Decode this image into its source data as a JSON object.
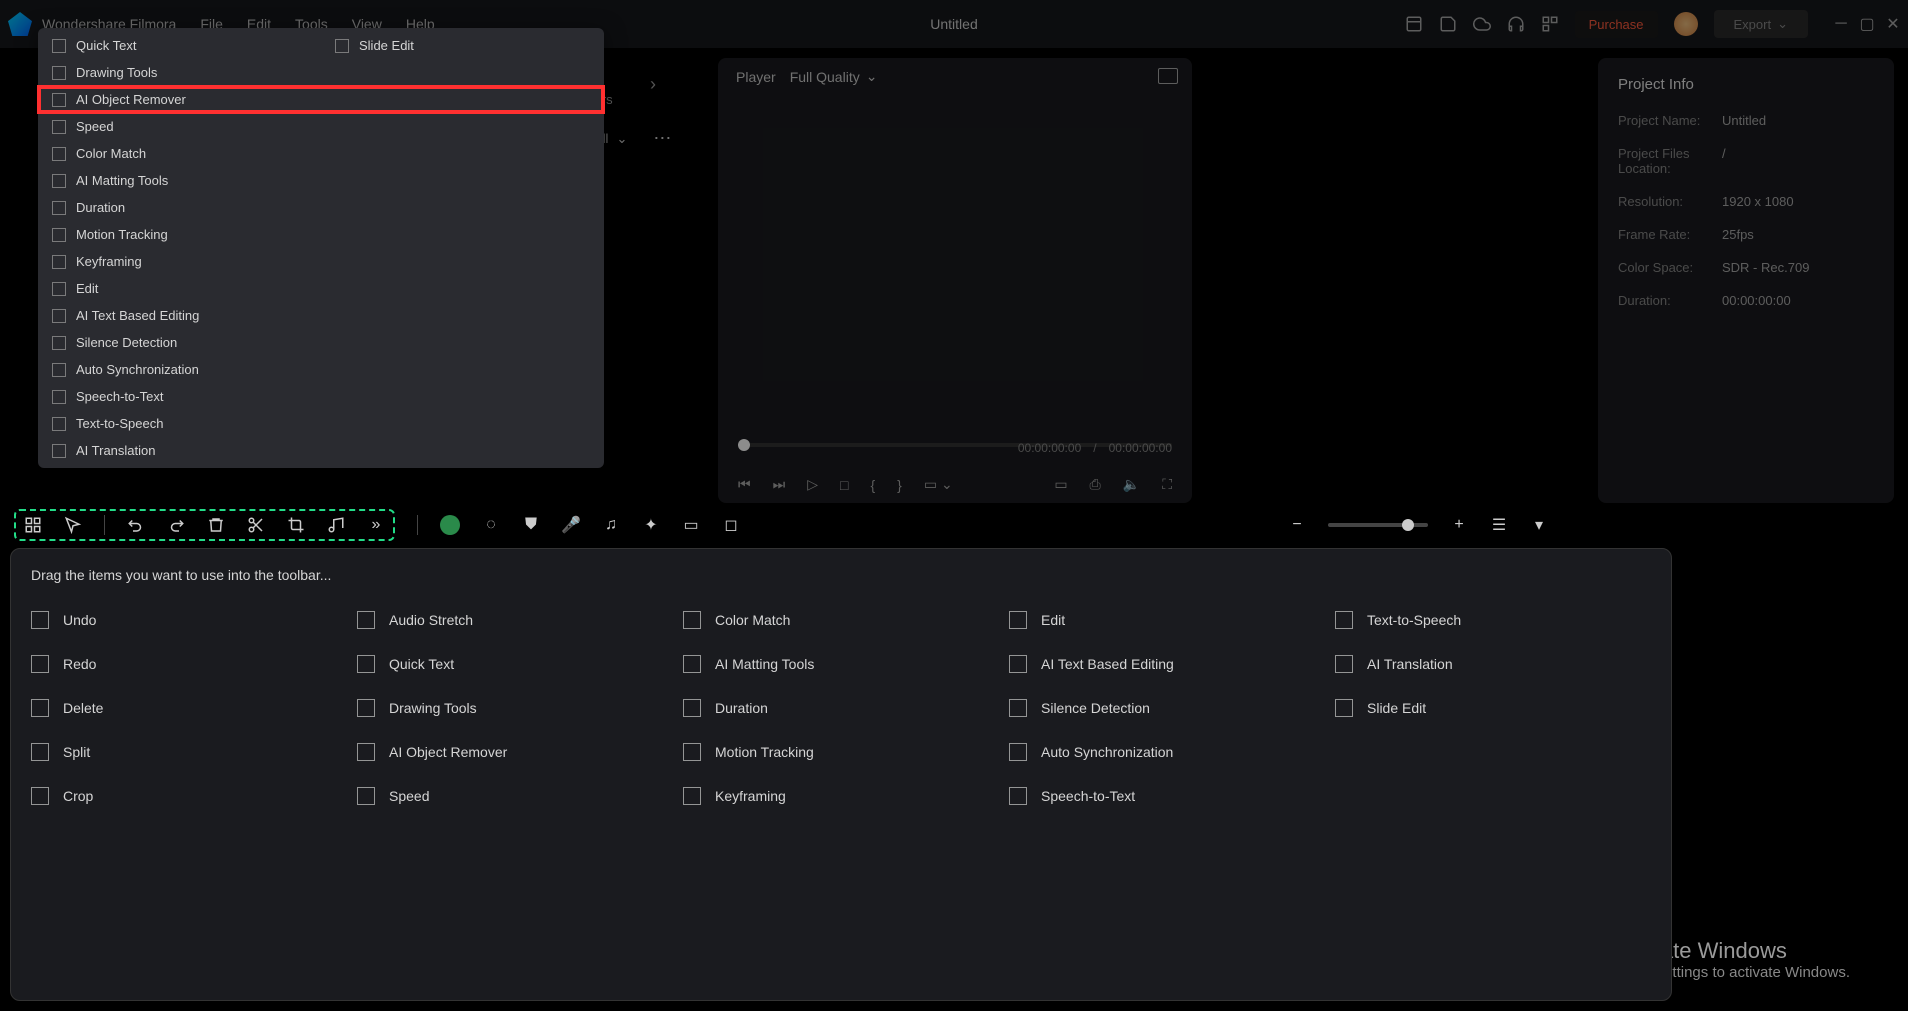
{
  "app": {
    "menubar": [
      "Wondershare Filmora",
      "File",
      "Edit",
      "Tools",
      "View",
      "Help"
    ],
    "title": "Untitled",
    "purchase": "Purchase",
    "export": "Export"
  },
  "dropdown": {
    "row1a": "Quick Text",
    "row1b": "Slide Edit",
    "items": [
      "Drawing Tools",
      "AI Object Remover",
      "Speed",
      "Color Match",
      "AI Matting Tools",
      "Duration",
      "Motion Tracking",
      "Keyframing",
      "Edit",
      "AI Text Based Editing",
      "Silence Detection",
      "Auto Synchronization",
      "Speech-to-Text",
      "Text-to-Speech",
      "AI Translation"
    ],
    "highlightedIndex": 1
  },
  "bg": {
    "filter_label": "ters",
    "all_label": "All"
  },
  "player": {
    "label": "Player",
    "quality": "Full Quality",
    "time_current": "00:00:00:00",
    "time_sep": "/",
    "time_total": "00:00:00:00"
  },
  "info": {
    "title": "Project Info",
    "rows": [
      {
        "label": "Project Name:",
        "value": "Untitled"
      },
      {
        "label": "Project Files Location:",
        "value": "/"
      },
      {
        "label": "Resolution:",
        "value": "1920 x 1080"
      },
      {
        "label": "Frame Rate:",
        "value": "25fps"
      },
      {
        "label": "Color Space:",
        "value": "SDR - Rec.709"
      },
      {
        "label": "Duration:",
        "value": "00:00:00:00"
      }
    ]
  },
  "drag": {
    "hint": "Drag the items you want to use into the toolbar...",
    "items": [
      "Undo",
      "Audio Stretch",
      "Color Match",
      "Edit",
      "Text-to-Speech",
      "Redo",
      "Quick Text",
      "AI Matting Tools",
      "AI Text Based Editing",
      "AI Translation",
      "Delete",
      "Drawing Tools",
      "Duration",
      "Silence Detection",
      "Slide Edit",
      "Split",
      "AI Object Remover",
      "Motion Tracking",
      "Auto Synchronization",
      "",
      "Crop",
      "Speed",
      "Keyframing",
      "Speech-to-Text",
      ""
    ]
  },
  "watermark": {
    "title": "Activate Windows",
    "sub": "Go to Settings to activate Windows."
  }
}
